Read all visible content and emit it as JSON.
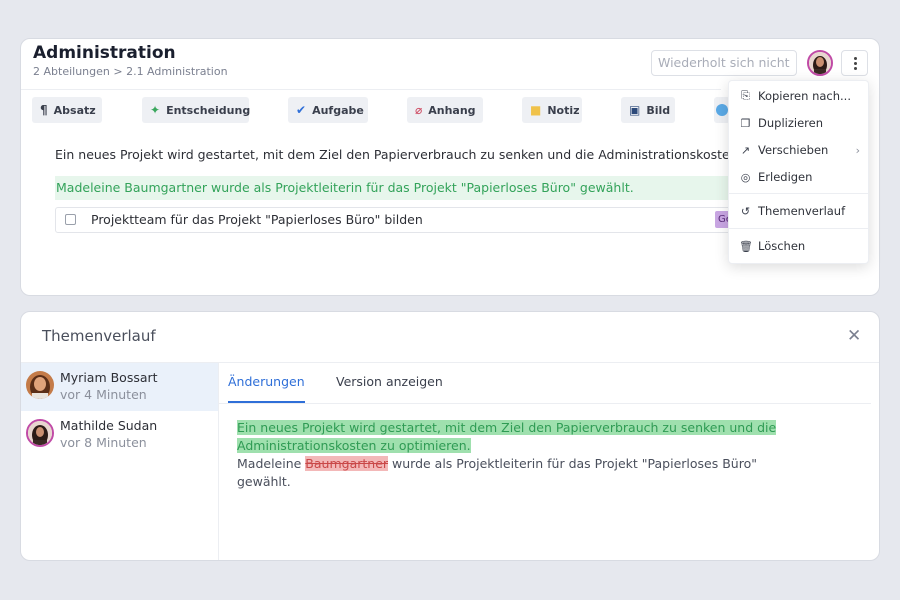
{
  "header": {
    "title": "Administration",
    "breadcrumb": "2 Abteilungen > 2.1 Administration",
    "repeat_label": "Wiederholt sich nicht"
  },
  "toolbar": {
    "items": [
      {
        "label": "Absatz",
        "icon": "paragraph-icon"
      },
      {
        "label": "Entscheidung",
        "icon": "wand-icon"
      },
      {
        "label": "Aufgabe",
        "icon": "check-icon"
      },
      {
        "label": "Anhang",
        "icon": "paperclip-icon"
      },
      {
        "label": "Notiz",
        "icon": "note-icon"
      },
      {
        "label": "Bild",
        "icon": "image-icon"
      }
    ]
  },
  "content": {
    "paragraph": "Ein neues Projekt wird gestartet, mit dem Ziel den Papierverbrauch zu senken und die Administrationskosten zu opti",
    "decision": "Madeleine Baumgartner wurde als Projektleiterin für das Projekt \"Papierloses Büro\" gewählt.",
    "task": "Projektteam für das Projekt \"Papierloses Büro\" bilden",
    "task_tag": "Ge"
  },
  "context_menu": {
    "items": [
      {
        "label": "Kopieren nach...",
        "icon": "copy-to-icon"
      },
      {
        "label": "Duplizieren",
        "icon": "duplicate-icon"
      },
      {
        "label": "Verschieben",
        "icon": "move-icon"
      },
      {
        "label": "Erledigen",
        "icon": "check-circle-icon"
      },
      {
        "label": "Themenverlauf",
        "icon": "history-icon"
      },
      {
        "label": "Löschen",
        "icon": "trash-icon"
      }
    ]
  },
  "history": {
    "title": "Themenverlauf",
    "entries": [
      {
        "name": "Myriam Bossart",
        "time": "vor 4 Minuten"
      },
      {
        "name": "Mathilde Sudan",
        "time": "vor 8 Minuten"
      }
    ],
    "tabs": [
      "Änderungen",
      "Version anzeigen"
    ],
    "diff": {
      "inserted": "Ein neues Projekt wird gestartet, mit dem Ziel den Papierverbrauch zu senken und die Administrationskosten zu optimieren.",
      "line2_prefix": "Madeleine ",
      "deleted": "Baumgartner",
      "line2_suffix": " wurde als Projektleiterin für das Projekt \"Papierloses Büro\" gewählt."
    }
  },
  "colors": {
    "accent": "#2f6fd8",
    "inserted_bg": "#9fe0ae",
    "deleted_bg": "#f3b8b8",
    "decision_bg": "#e7f6ec"
  }
}
